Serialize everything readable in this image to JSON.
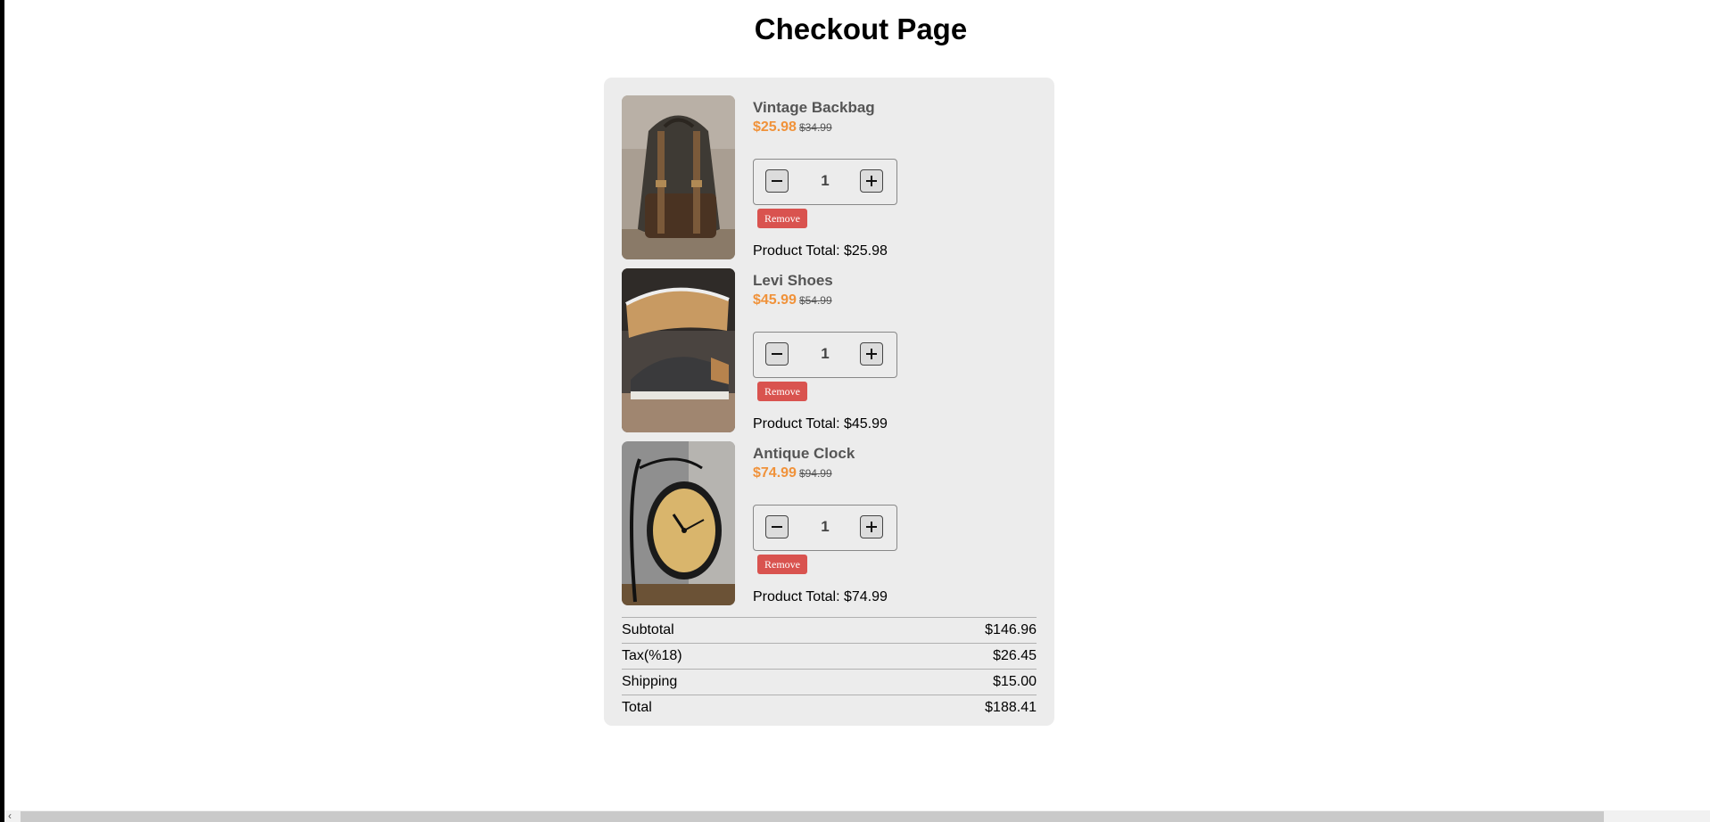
{
  "page": {
    "title": "Checkout Page"
  },
  "cart": {
    "items": [
      {
        "name": "Vintage Backbag",
        "price": "$25.98",
        "original_price": "$34.99",
        "quantity": "1",
        "remove_label": "Remove",
        "total_text": "Product Total: $25.98",
        "image": "backpack-photo"
      },
      {
        "name": "Levi Shoes",
        "price": "$45.99",
        "original_price": "$54.99",
        "quantity": "1",
        "remove_label": "Remove",
        "total_text": "Product Total: $45.99",
        "image": "shoes-photo"
      },
      {
        "name": "Antique Clock",
        "price": "$74.99",
        "original_price": "$94.99",
        "quantity": "1",
        "remove_label": "Remove",
        "total_text": "Product Total: $74.99",
        "image": "clock-photo"
      }
    ]
  },
  "summary": {
    "subtotal_label": "Subtotal",
    "subtotal_value": "$146.96",
    "tax_label": "Tax(%18)",
    "tax_value": "$26.45",
    "shipping_label": "Shipping",
    "shipping_value": "$15.00",
    "total_label": "Total",
    "total_value": "$188.41"
  },
  "colors": {
    "sale_price": "#f0923a",
    "remove_button": "#d9534f",
    "card_background": "#ececec"
  },
  "icons": {
    "decrease": "minus-icon",
    "increase": "plus-icon",
    "scroll_left": "chevron-left-icon"
  }
}
